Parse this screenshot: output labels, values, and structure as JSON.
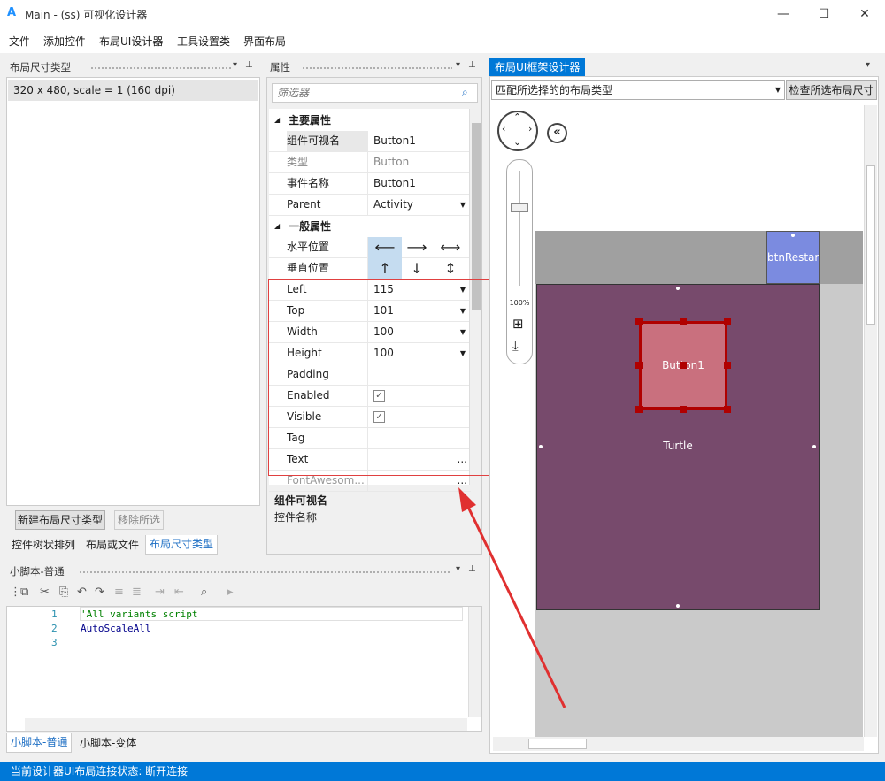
{
  "window": {
    "logo": "A",
    "title": "Main - (ss) 可视化设计器",
    "minimize": "—",
    "maximize": "☐",
    "close": "✕"
  },
  "menu": [
    "文件",
    "添加控件",
    "布局UI设计器",
    "工具设置类",
    "界面布局"
  ],
  "layout_panel": {
    "title": "布局尺寸类型",
    "item": "320 x 480, scale = 1 (160 dpi)",
    "new_button": "新建布局尺寸类型",
    "remove_button": "移除所选",
    "tabs": [
      "控件树状排列",
      "布局或文件",
      "布局尺寸类型"
    ]
  },
  "props_panel": {
    "title": "属性",
    "filter_placeholder": "筛选器",
    "cat_main": "主要属性",
    "cat_general": "一般属性",
    "rows_main": [
      {
        "k": "组件可视名",
        "v": "Button1"
      },
      {
        "k": "类型",
        "v": "Button"
      },
      {
        "k": "事件名称",
        "v": "Button1"
      },
      {
        "k": "Parent",
        "v": "Activity"
      }
    ],
    "halign_label": "水平位置",
    "valign_label": "垂直位置",
    "rows_general": [
      {
        "k": "Left",
        "v": "115"
      },
      {
        "k": "Top",
        "v": "101"
      },
      {
        "k": "Width",
        "v": "100"
      },
      {
        "k": "Height",
        "v": "100"
      },
      {
        "k": "Padding",
        "v": ""
      },
      {
        "k": "Enabled",
        "v": "✓"
      },
      {
        "k": "Visible",
        "v": "✓"
      },
      {
        "k": "Tag",
        "v": ""
      },
      {
        "k": "Text",
        "v": "..."
      },
      {
        "k": "FontAwesom...",
        "v": "..."
      }
    ],
    "desc_title": "组件可视名",
    "desc_text": "控件名称"
  },
  "script_panel": {
    "title": "小脚本-普通",
    "lines": [
      "'All variants script",
      "AutoScaleAll",
      ""
    ],
    "tabs": [
      "小脚本-普通",
      "小脚本-变体"
    ]
  },
  "designer": {
    "tab": "布局UI框架设计器",
    "select_value": "匹配所选择的的布局类型",
    "check_button": "检查所选布局尺寸",
    "zoom": "100%",
    "btn_restart": "btnRestart",
    "button1": "Button1",
    "turtle": "Turtle"
  },
  "status": "当前设计器UI布局连接状态: 断开连接",
  "colors": {
    "accent": "#0078d7",
    "turtle_panel": "#774a6c",
    "button1": "#c9707e",
    "btn_restart": "#7b8be0",
    "selection": "#b00000"
  }
}
